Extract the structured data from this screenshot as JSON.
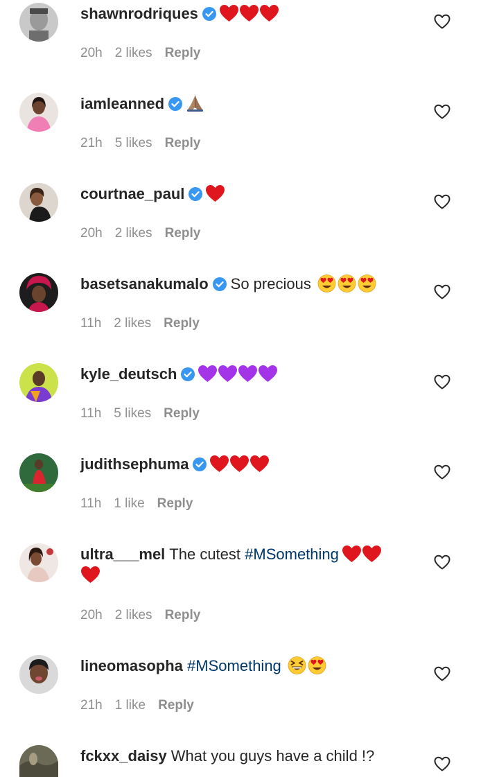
{
  "comments": [
    {
      "username": "shawnrodriques",
      "verified": true,
      "text": "",
      "hashtag": "",
      "emojis": [
        "red-heart",
        "red-heart",
        "red-heart"
      ],
      "time": "20h",
      "likes": "2 likes",
      "reply": "Reply"
    },
    {
      "username": "iamleanned",
      "verified": true,
      "text": "",
      "hashtag": "",
      "emojis": [
        "folded-hands"
      ],
      "time": "21h",
      "likes": "5 likes",
      "reply": "Reply"
    },
    {
      "username": "courtnae_paul",
      "verified": true,
      "text": "",
      "hashtag": "",
      "emojis": [
        "red-heart"
      ],
      "time": "20h",
      "likes": "2 likes",
      "reply": "Reply"
    },
    {
      "username": "basetsanakumalo",
      "verified": true,
      "text": "So precious",
      "hashtag": "",
      "emojis": [
        "heart-eyes",
        "heart-eyes",
        "heart-eyes"
      ],
      "time": "11h",
      "likes": "2 likes",
      "reply": "Reply"
    },
    {
      "username": "kyle_deutsch",
      "verified": true,
      "text": "",
      "hashtag": "",
      "emojis": [
        "purple-heart",
        "purple-heart",
        "purple-heart",
        "purple-heart"
      ],
      "time": "11h",
      "likes": "5 likes",
      "reply": "Reply"
    },
    {
      "username": "judithsephuma",
      "verified": true,
      "text": "",
      "hashtag": "",
      "emojis": [
        "red-heart",
        "red-heart",
        "red-heart"
      ],
      "time": "11h",
      "likes": "1 like",
      "reply": "Reply"
    },
    {
      "username": "ultra___mel",
      "verified": false,
      "text": "The cutest",
      "hashtag": "#MSomething",
      "emojis": [
        "red-heart",
        "red-heart",
        "red-heart"
      ],
      "time": "20h",
      "likes": "2 likes",
      "reply": "Reply"
    },
    {
      "username": "lineomasopha",
      "verified": false,
      "text": "",
      "hashtag": "#MSomething",
      "emojis": [
        "grinning-squint",
        "heart-eyes"
      ],
      "time": "21h",
      "likes": "1 like",
      "reply": "Reply"
    },
    {
      "username": "fckxx_daisy",
      "verified": false,
      "text": "What you guys have a child !?",
      "hashtag": "",
      "emojis": [],
      "time": "",
      "likes": "",
      "reply": ""
    }
  ],
  "colors": {
    "text": "#262626",
    "secondary": "#8e8e8e",
    "hashtag": "#00376b",
    "verified": "#3897f0",
    "red_heart": "#e0161e",
    "purple_heart": "#a434e8"
  },
  "icons": {
    "like": "heart-outline-icon",
    "verified": "verified-badge-icon"
  }
}
